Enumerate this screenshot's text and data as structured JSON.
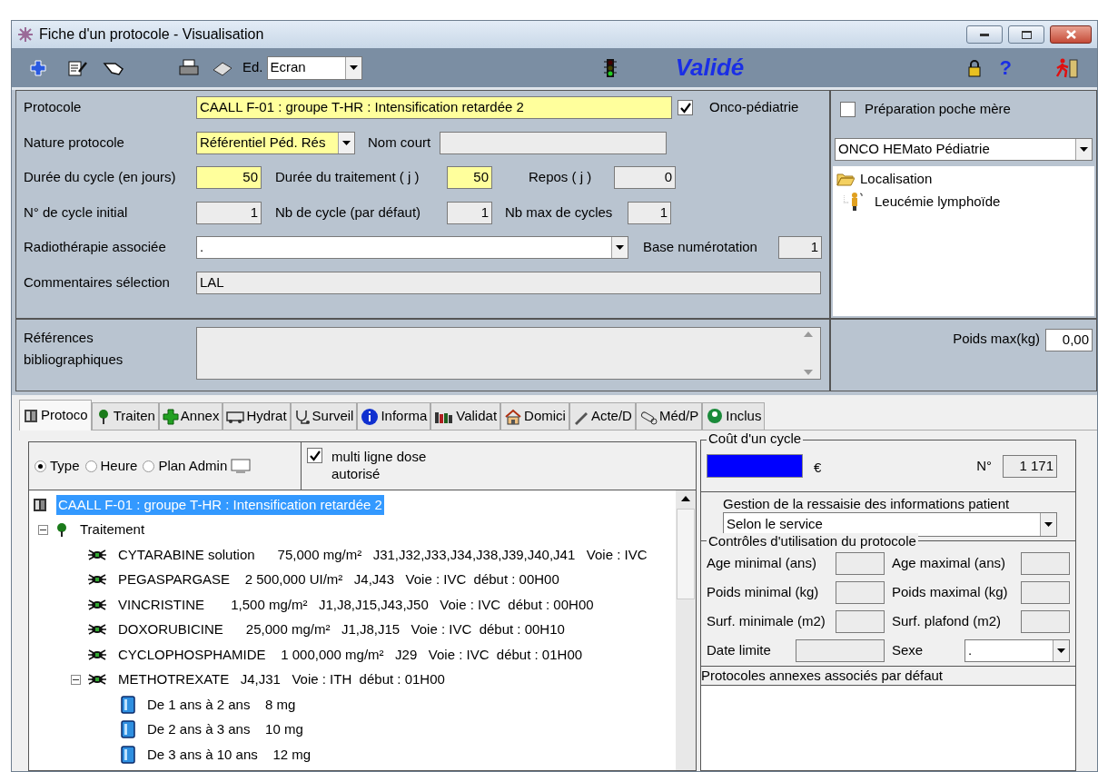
{
  "window": {
    "title": "Fiche d'un protocole - Visualisation"
  },
  "toolbar": {
    "edition_label": "Ed.",
    "edition_value": "Ecran",
    "status": "Validé",
    "help": "?"
  },
  "form": {
    "protocole": {
      "label": "Protocole",
      "value": "CAALL F-01 : groupe T-HR : Intensification retardée 2"
    },
    "onco_pediatrie": {
      "label": "Onco-pédiatrie",
      "checked": true
    },
    "nature": {
      "label": "Nature protocole",
      "value": "Référentiel Péd. Rés"
    },
    "nom_court": {
      "label": "Nom court"
    },
    "duree_cycle": {
      "label": "Durée du cycle (en jours)",
      "value": "50"
    },
    "duree_traitement": {
      "label": "Durée du traitement ( j )",
      "value": "50"
    },
    "repos": {
      "label": "Repos ( j )",
      "value": "0"
    },
    "cycle_initial": {
      "label": "N° de cycle initial",
      "value": "1"
    },
    "nb_cycle": {
      "label": "Nb de cycle (par défaut)",
      "value": "1"
    },
    "nb_max": {
      "label": "Nb max de cycles",
      "value": "1"
    },
    "radiotherapie": {
      "label": "Radiothérapie associée",
      "value": "."
    },
    "base_numerotation": {
      "label": "Base numérotation",
      "value": "1"
    },
    "commentaires": {
      "label": "Commentaires sélection",
      "value": "LAL"
    },
    "references": {
      "label": "Références bibliographiques"
    }
  },
  "side": {
    "preparation": {
      "label": "Préparation poche mère",
      "checked": false
    },
    "service": "ONCO HEMato Pédiatrie",
    "localisation": {
      "label": "Localisation",
      "expanded": true,
      "children": [
        {
          "label": "Leucémie lymphoïde"
        }
      ]
    },
    "poids_max": {
      "label": "Poids max(kg)",
      "value": "0,00"
    }
  },
  "tabs": [
    {
      "label": "Protoco",
      "selected": true
    },
    {
      "label": "Traiten",
      "selected": false
    },
    {
      "label": "Annex",
      "selected": false
    },
    {
      "label": "Hydrat",
      "selected": false
    },
    {
      "label": "Surveil",
      "selected": false
    },
    {
      "label": "Informa",
      "selected": false
    },
    {
      "label": "Validat",
      "selected": false
    },
    {
      "label": "Domici",
      "selected": false
    },
    {
      "label": "Acte/D",
      "selected": false
    },
    {
      "label": "Méd/P",
      "selected": false
    },
    {
      "label": "Inclus",
      "selected": false
    }
  ],
  "view_options": [
    {
      "label": "Type",
      "selected": true
    },
    {
      "label": "Heure",
      "selected": false
    },
    {
      "label": "Plan Admin",
      "selected": false
    }
  ],
  "multi_ligne": {
    "label": "multi ligne dose autorisé",
    "checked": true
  },
  "tree": [
    {
      "kind": "protocol",
      "label": "CAALL F-01 : groupe T-HR : Intensification retardée 2",
      "selected": true,
      "children": [
        {
          "kind": "group",
          "label": "Traitement",
          "selected": false,
          "expanded": true,
          "children": [
            {
              "kind": "drug",
              "label": "CYTARABINE solution      75,000 mg/m²   J31,J32,J33,J34,J38,J39,J40,J41   Voie : IVC",
              "selected": false
            },
            {
              "kind": "drug",
              "label": "PEGASPARGASE    2 500,000 UI/m²   J4,J43   Voie : IVC  début : 00H00",
              "selected": false
            },
            {
              "kind": "drug",
              "label": "VINCRISTINE       1,500 mg/m²   J1,J8,J15,J43,J50   Voie : IVC  début : 00H00",
              "selected": false
            },
            {
              "kind": "drug",
              "label": "DOXORUBICINE      25,000 mg/m²   J1,J8,J15   Voie : IVC  début : 00H10",
              "selected": false
            },
            {
              "kind": "drug",
              "label": "CYCLOPHOSPHAMIDE    1 000,000 mg/m²   J29   Voie : IVC  début : 01H00",
              "selected": false
            },
            {
              "kind": "drug",
              "label": "METHOTREXATE   J4,J31   Voie : ITH  début : 01H00",
              "selected": false,
              "expanded": true,
              "children": [
                {
                  "kind": "dose",
                  "label": "De 1 ans à 2 ans    8 mg",
                  "selected": false
                },
                {
                  "kind": "dose",
                  "label": "De 2 ans à 3 ans    10 mg",
                  "selected": false
                },
                {
                  "kind": "dose",
                  "label": "De 3 ans à 10 ans    12 mg",
                  "selected": false
                }
              ]
            }
          ]
        }
      ]
    }
  ],
  "cost": {
    "title": "Coût d'un cycle",
    "currency": "€",
    "number_label": "N°",
    "number": "1 171"
  },
  "gestion": {
    "label": "Gestion de la ressaisie des informations patient",
    "value": "Selon le service"
  },
  "controles": {
    "title": "Contrôles d'utilisation du protocole",
    "fields": [
      {
        "label": "Age minimal (ans)"
      },
      {
        "label": "Age maximal (ans)"
      },
      {
        "label": "Poids minimal (kg)"
      },
      {
        "label": "Poids maximal (kg)"
      },
      {
        "label": "Surf. minimale (m2)"
      },
      {
        "label": "Surf. plafond (m2)"
      },
      {
        "label": "Date limite"
      }
    ],
    "sexe": {
      "label": "Sexe",
      "value": "."
    }
  },
  "annexes": {
    "title": "Protocoles annexes associés par défaut"
  }
}
